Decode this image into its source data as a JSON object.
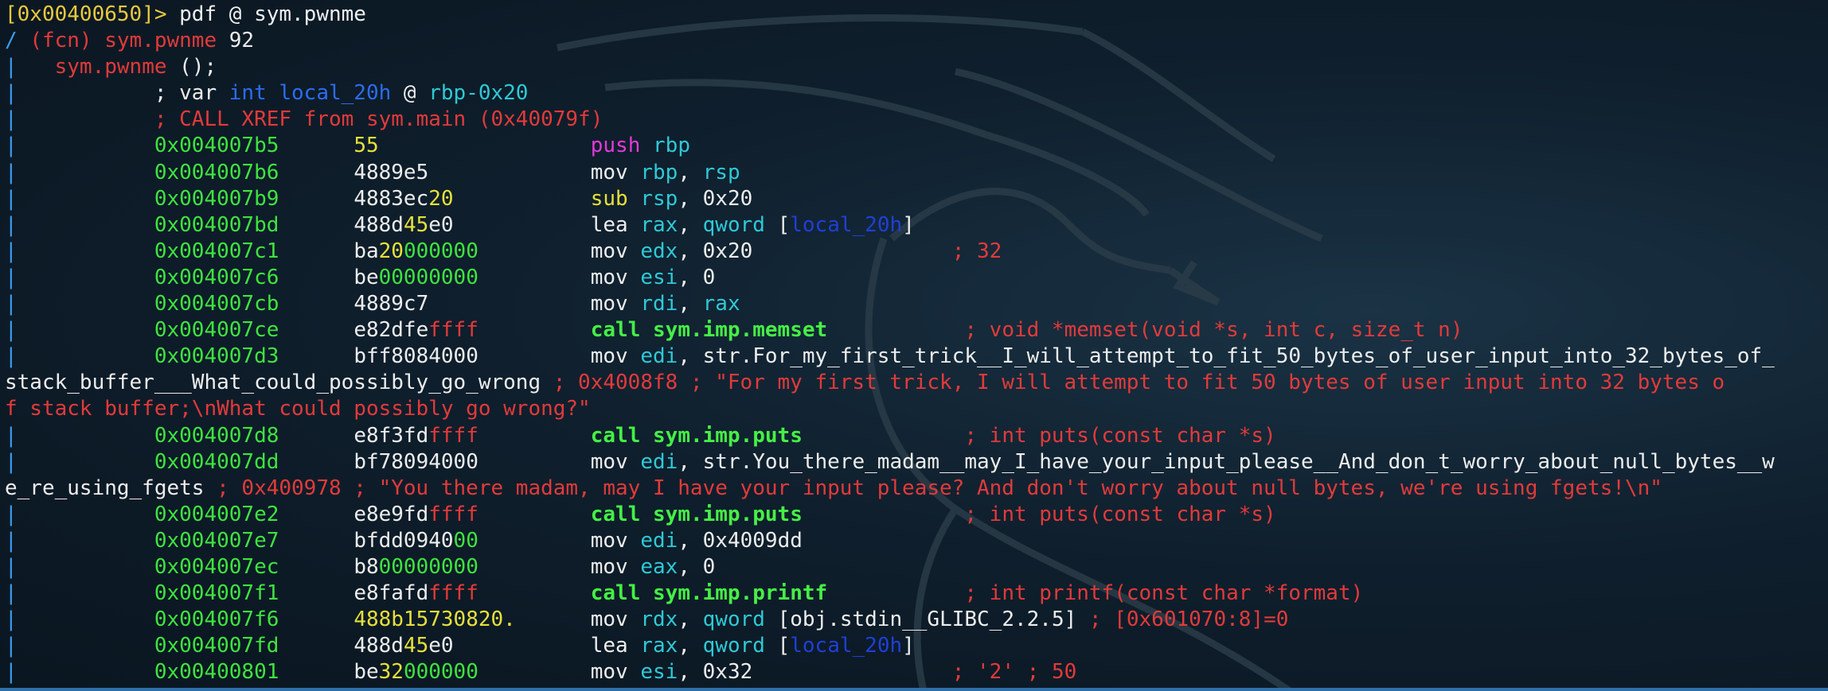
{
  "terminal": {
    "lines": [
      {
        "segs": [
          {
            "t": "[0x00400650]>",
            "c": "c-prompt"
          },
          {
            "t": " pdf @ sym.pwnme",
            "c": "c-cmd"
          }
        ]
      },
      {
        "segs": [
          {
            "t": "/ ",
            "c": "c-pipe"
          },
          {
            "t": "(fcn) sym.pwnme",
            "c": "c-red"
          },
          {
            "t": " 92",
            "c": "c-white"
          }
        ]
      },
      {
        "segs": [
          {
            "t": "|   ",
            "c": "c-pipe"
          },
          {
            "t": "sym.pwnme",
            "c": "c-red"
          },
          {
            "t": " ();",
            "c": "c-white"
          }
        ]
      },
      {
        "segs": [
          {
            "t": "|           ",
            "c": "c-pipe"
          },
          {
            "t": "; var ",
            "c": "c-white"
          },
          {
            "t": "int local_20h",
            "c": "c-blue"
          },
          {
            "t": " @ ",
            "c": "c-white"
          },
          {
            "t": "rbp-0x20",
            "c": "c-cyan"
          }
        ]
      },
      {
        "segs": [
          {
            "t": "|           ",
            "c": "c-pipe"
          },
          {
            "t": "; CALL XREF from sym.main (0x40079f)",
            "c": "c-red"
          }
        ]
      },
      {
        "segs": [
          {
            "t": "|           ",
            "c": "c-pipe"
          },
          {
            "t": "0x004007b5",
            "c": "c-green"
          },
          {
            "t": "      ",
            "c": "c-white"
          },
          {
            "t": "55",
            "c": "c-yellow"
          },
          {
            "t": "                 ",
            "c": "c-white"
          },
          {
            "t": "push",
            "c": "c-magenta"
          },
          {
            "t": " rbp",
            "c": "c-cyan"
          }
        ]
      },
      {
        "segs": [
          {
            "t": "|           ",
            "c": "c-pipe"
          },
          {
            "t": "0x004007b6",
            "c": "c-green"
          },
          {
            "t": "      ",
            "c": "c-white"
          },
          {
            "t": "4889e5",
            "c": "c-white"
          },
          {
            "t": "             ",
            "c": "c-white"
          },
          {
            "t": "mov ",
            "c": "c-white"
          },
          {
            "t": "rbp",
            "c": "c-cyan"
          },
          {
            "t": ", ",
            "c": "c-white"
          },
          {
            "t": "rsp",
            "c": "c-cyan"
          }
        ]
      },
      {
        "segs": [
          {
            "t": "|           ",
            "c": "c-pipe"
          },
          {
            "t": "0x004007b9",
            "c": "c-green"
          },
          {
            "t": "      ",
            "c": "c-white"
          },
          {
            "t": "4883ec",
            "c": "c-white"
          },
          {
            "t": "20",
            "c": "c-yellow"
          },
          {
            "t": "           ",
            "c": "c-white"
          },
          {
            "t": "sub ",
            "c": "c-yellow"
          },
          {
            "t": "rsp",
            "c": "c-cyan"
          },
          {
            "t": ", 0x20",
            "c": "c-white"
          }
        ]
      },
      {
        "segs": [
          {
            "t": "|           ",
            "c": "c-pipe"
          },
          {
            "t": "0x004007bd",
            "c": "c-green"
          },
          {
            "t": "      ",
            "c": "c-white"
          },
          {
            "t": "488d",
            "c": "c-white"
          },
          {
            "t": "45",
            "c": "c-yellow"
          },
          {
            "t": "e0",
            "c": "c-white"
          },
          {
            "t": "           ",
            "c": "c-white"
          },
          {
            "t": "lea ",
            "c": "c-white"
          },
          {
            "t": "rax",
            "c": "c-cyan"
          },
          {
            "t": ", ",
            "c": "c-white"
          },
          {
            "t": "qword",
            "c": "c-cyan"
          },
          {
            "t": " [",
            "c": "c-white"
          },
          {
            "t": "local_20h",
            "c": "c-darkblue"
          },
          {
            "t": "]",
            "c": "c-white"
          }
        ]
      },
      {
        "segs": [
          {
            "t": "|           ",
            "c": "c-pipe"
          },
          {
            "t": "0x004007c1",
            "c": "c-green"
          },
          {
            "t": "      ",
            "c": "c-white"
          },
          {
            "t": "ba",
            "c": "c-white"
          },
          {
            "t": "20",
            "c": "c-yellow"
          },
          {
            "t": "000000",
            "c": "c-green"
          },
          {
            "t": "         ",
            "c": "c-white"
          },
          {
            "t": "mov ",
            "c": "c-white"
          },
          {
            "t": "edx",
            "c": "c-cyan"
          },
          {
            "t": ", 0x20",
            "c": "c-white"
          },
          {
            "t": "                ",
            "c": "c-white"
          },
          {
            "t": "; 32",
            "c": "c-red"
          }
        ]
      },
      {
        "segs": [
          {
            "t": "|           ",
            "c": "c-pipe"
          },
          {
            "t": "0x004007c6",
            "c": "c-green"
          },
          {
            "t": "      ",
            "c": "c-white"
          },
          {
            "t": "be",
            "c": "c-white"
          },
          {
            "t": "00000000",
            "c": "c-green"
          },
          {
            "t": "         ",
            "c": "c-white"
          },
          {
            "t": "mov ",
            "c": "c-white"
          },
          {
            "t": "esi",
            "c": "c-cyan"
          },
          {
            "t": ", 0",
            "c": "c-white"
          }
        ]
      },
      {
        "segs": [
          {
            "t": "|           ",
            "c": "c-pipe"
          },
          {
            "t": "0x004007cb",
            "c": "c-green"
          },
          {
            "t": "      ",
            "c": "c-white"
          },
          {
            "t": "4889c7",
            "c": "c-white"
          },
          {
            "t": "             ",
            "c": "c-white"
          },
          {
            "t": "mov ",
            "c": "c-white"
          },
          {
            "t": "rdi",
            "c": "c-cyan"
          },
          {
            "t": ", ",
            "c": "c-white"
          },
          {
            "t": "rax",
            "c": "c-cyan"
          }
        ]
      },
      {
        "segs": [
          {
            "t": "|           ",
            "c": "c-pipe"
          },
          {
            "t": "0x004007ce",
            "c": "c-green"
          },
          {
            "t": "      ",
            "c": "c-white"
          },
          {
            "t": "e82dfe",
            "c": "c-white"
          },
          {
            "t": "ffff",
            "c": "c-red"
          },
          {
            "t": "         ",
            "c": "c-white"
          },
          {
            "t": "call sym.imp.memset",
            "c": "c-boldgreen"
          },
          {
            "t": "           ",
            "c": "c-white"
          },
          {
            "t": "; void *memset(void *s, int c, size_t n)",
            "c": "c-red"
          }
        ]
      },
      {
        "segs": [
          {
            "t": "|           ",
            "c": "c-pipe"
          },
          {
            "t": "0x004007d3",
            "c": "c-green"
          },
          {
            "t": "      ",
            "c": "c-white"
          },
          {
            "t": "bff8084000",
            "c": "c-white"
          },
          {
            "t": "         ",
            "c": "c-white"
          },
          {
            "t": "mov ",
            "c": "c-white"
          },
          {
            "t": "edi",
            "c": "c-cyan"
          },
          {
            "t": ", str.For_my_first_trick__I_will_attempt_to_fit_50_bytes_of_user_input_into_32_bytes_of_",
            "c": "c-white"
          }
        ]
      },
      {
        "segs": [
          {
            "t": "stack_buffer___What_could_possibly_go_wrong",
            "c": "c-white"
          },
          {
            "t": " ; 0x4008f8 ; \"For my first trick, I will attempt to fit 50 bytes of user input into 32 bytes o",
            "c": "c-red"
          }
        ]
      },
      {
        "segs": [
          {
            "t": "f stack buffer;\\nWhat could possibly go wrong?\"",
            "c": "c-red"
          }
        ]
      },
      {
        "segs": [
          {
            "t": "|           ",
            "c": "c-pipe"
          },
          {
            "t": "0x004007d8",
            "c": "c-green"
          },
          {
            "t": "      ",
            "c": "c-white"
          },
          {
            "t": "e8f3fd",
            "c": "c-white"
          },
          {
            "t": "ffff",
            "c": "c-red"
          },
          {
            "t": "         ",
            "c": "c-white"
          },
          {
            "t": "call sym.imp.puts",
            "c": "c-boldgreen"
          },
          {
            "t": "             ",
            "c": "c-white"
          },
          {
            "t": "; int puts(const char *s)",
            "c": "c-red"
          }
        ]
      },
      {
        "segs": [
          {
            "t": "|           ",
            "c": "c-pipe"
          },
          {
            "t": "0x004007dd",
            "c": "c-green"
          },
          {
            "t": "      ",
            "c": "c-white"
          },
          {
            "t": "bf78094000",
            "c": "c-white"
          },
          {
            "t": "         ",
            "c": "c-white"
          },
          {
            "t": "mov ",
            "c": "c-white"
          },
          {
            "t": "edi",
            "c": "c-cyan"
          },
          {
            "t": ", str.You_there_madam__may_I_have_your_input_please__And_don_t_worry_about_null_bytes__w",
            "c": "c-white"
          }
        ]
      },
      {
        "segs": [
          {
            "t": "e_re_using_fgets",
            "c": "c-white"
          },
          {
            "t": " ; 0x400978 ; \"You there madam, may I have your input please? And don't worry about null bytes, we're using fgets!\\n\"",
            "c": "c-red"
          }
        ]
      },
      {
        "segs": [
          {
            "t": "|           ",
            "c": "c-pipe"
          },
          {
            "t": "0x004007e2",
            "c": "c-green"
          },
          {
            "t": "      ",
            "c": "c-white"
          },
          {
            "t": "e8e9fd",
            "c": "c-white"
          },
          {
            "t": "ffff",
            "c": "c-red"
          },
          {
            "t": "         ",
            "c": "c-white"
          },
          {
            "t": "call sym.imp.puts",
            "c": "c-boldgreen"
          },
          {
            "t": "             ",
            "c": "c-white"
          },
          {
            "t": "; int puts(const char *s)",
            "c": "c-red"
          }
        ]
      },
      {
        "segs": [
          {
            "t": "|           ",
            "c": "c-pipe"
          },
          {
            "t": "0x004007e7",
            "c": "c-green"
          },
          {
            "t": "      ",
            "c": "c-white"
          },
          {
            "t": "bfdd0940",
            "c": "c-white"
          },
          {
            "t": "00",
            "c": "c-green"
          },
          {
            "t": "         ",
            "c": "c-white"
          },
          {
            "t": "mov ",
            "c": "c-white"
          },
          {
            "t": "edi",
            "c": "c-cyan"
          },
          {
            "t": ", 0x4009dd",
            "c": "c-white"
          }
        ]
      },
      {
        "segs": [
          {
            "t": "|           ",
            "c": "c-pipe"
          },
          {
            "t": "0x004007ec",
            "c": "c-green"
          },
          {
            "t": "      ",
            "c": "c-white"
          },
          {
            "t": "b8",
            "c": "c-white"
          },
          {
            "t": "00000000",
            "c": "c-green"
          },
          {
            "t": "         ",
            "c": "c-white"
          },
          {
            "t": "mov ",
            "c": "c-white"
          },
          {
            "t": "eax",
            "c": "c-cyan"
          },
          {
            "t": ", 0",
            "c": "c-white"
          }
        ]
      },
      {
        "segs": [
          {
            "t": "|           ",
            "c": "c-pipe"
          },
          {
            "t": "0x004007f1",
            "c": "c-green"
          },
          {
            "t": "      ",
            "c": "c-white"
          },
          {
            "t": "e8fafd",
            "c": "c-white"
          },
          {
            "t": "ffff",
            "c": "c-red"
          },
          {
            "t": "         ",
            "c": "c-white"
          },
          {
            "t": "call sym.imp.printf",
            "c": "c-boldgreen"
          },
          {
            "t": "           ",
            "c": "c-white"
          },
          {
            "t": "; int printf(const char *format)",
            "c": "c-red"
          }
        ]
      },
      {
        "segs": [
          {
            "t": "|           ",
            "c": "c-pipe"
          },
          {
            "t": "0x004007f6",
            "c": "c-green"
          },
          {
            "t": "      ",
            "c": "c-white"
          },
          {
            "t": "488b15730820.",
            "c": "c-yellow"
          },
          {
            "t": "      ",
            "c": "c-white"
          },
          {
            "t": "mov ",
            "c": "c-white"
          },
          {
            "t": "rdx",
            "c": "c-cyan"
          },
          {
            "t": ", ",
            "c": "c-white"
          },
          {
            "t": "qword",
            "c": "c-cyan"
          },
          {
            "t": " [obj.stdin__GLIBC_2.2.5]",
            "c": "c-white"
          },
          {
            "t": " ; [0x601070:8]=0",
            "c": "c-red"
          }
        ]
      },
      {
        "segs": [
          {
            "t": "|           ",
            "c": "c-pipe"
          },
          {
            "t": "0x004007fd",
            "c": "c-green"
          },
          {
            "t": "      ",
            "c": "c-white"
          },
          {
            "t": "488d",
            "c": "c-white"
          },
          {
            "t": "45",
            "c": "c-yellow"
          },
          {
            "t": "e0",
            "c": "c-white"
          },
          {
            "t": "           ",
            "c": "c-white"
          },
          {
            "t": "lea ",
            "c": "c-white"
          },
          {
            "t": "rax",
            "c": "c-cyan"
          },
          {
            "t": ", ",
            "c": "c-white"
          },
          {
            "t": "qword",
            "c": "c-cyan"
          },
          {
            "t": " [",
            "c": "c-white"
          },
          {
            "t": "local_20h",
            "c": "c-darkblue"
          },
          {
            "t": "]",
            "c": "c-white"
          }
        ]
      },
      {
        "segs": [
          {
            "t": "|           ",
            "c": "c-pipe"
          },
          {
            "t": "0x00400801",
            "c": "c-green"
          },
          {
            "t": "      ",
            "c": "c-white"
          },
          {
            "t": "be",
            "c": "c-white"
          },
          {
            "t": "32",
            "c": "c-yellow"
          },
          {
            "t": "000000",
            "c": "c-green"
          },
          {
            "t": "         ",
            "c": "c-white"
          },
          {
            "t": "mov ",
            "c": "c-white"
          },
          {
            "t": "esi",
            "c": "c-cyan"
          },
          {
            "t": ", 0x32",
            "c": "c-white"
          },
          {
            "t": "                ",
            "c": "c-white"
          },
          {
            "t": "; '2' ; 50",
            "c": "c-red"
          }
        ]
      }
    ]
  }
}
